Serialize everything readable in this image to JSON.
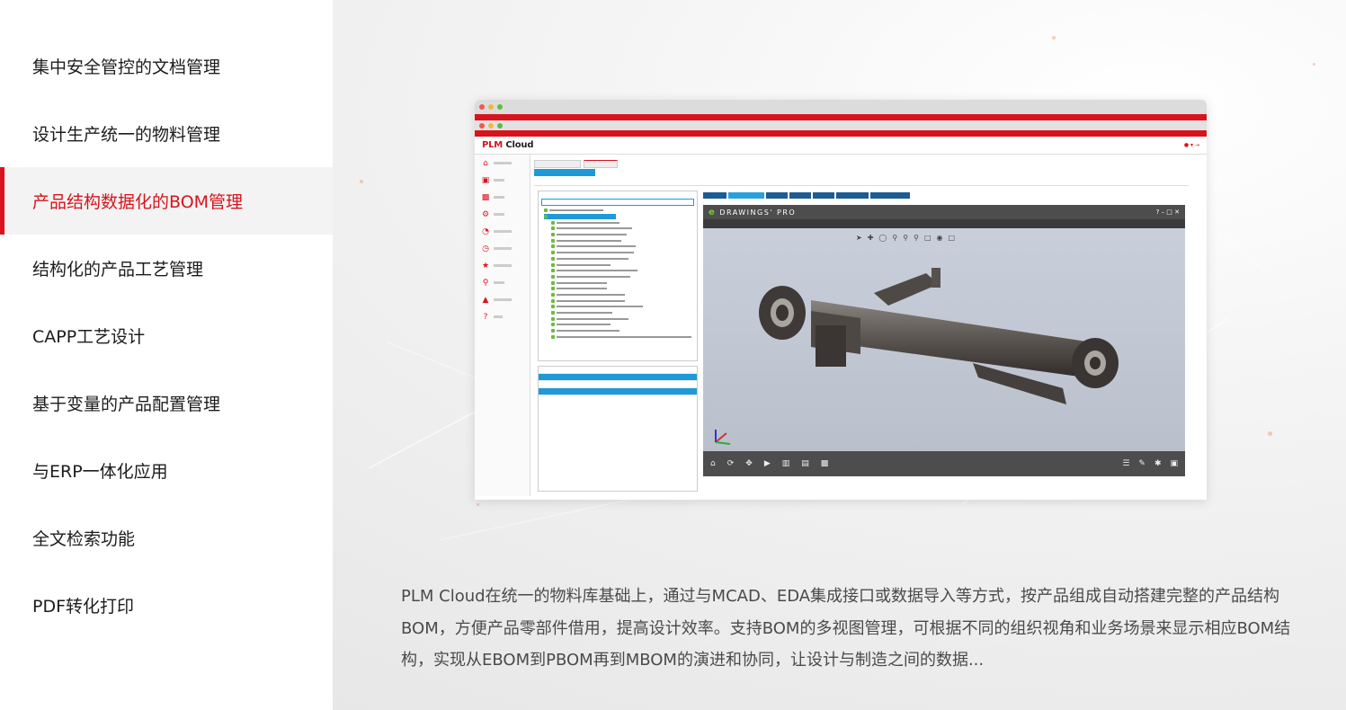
{
  "sidebar": {
    "items": [
      {
        "label": "集中安全管控的文档管理",
        "active": false
      },
      {
        "label": "设计生产统一的物料管理",
        "active": false
      },
      {
        "label": "产品结构数据化的BOM管理",
        "active": true
      },
      {
        "label": "结构化的产品工艺管理",
        "active": false
      },
      {
        "label": "CAPP工艺设计",
        "active": false
      },
      {
        "label": "基于变量的产品配置管理",
        "active": false
      },
      {
        "label": "与ERP一体化应用",
        "active": false
      },
      {
        "label": "全文检索功能",
        "active": false
      },
      {
        "label": "PDF转化打印",
        "active": false
      }
    ],
    "active_color": "#d8131d"
  },
  "screenshot": {
    "logo_accent": "PLM",
    "logo_rest": "Cloud",
    "viewer_logo_e": "e",
    "viewer_logo_text": "DRAWINGS' PRO"
  },
  "description": "PLM Cloud在统一的物料库基础上，通过与MCAD、EDA集成接口或数据导入等方式，按产品组成自动搭建完整的产品结构BOM，方便产品零部件借用，提高设计效率。支持BOM的多视图管理，可根据不同的组织视角和业务场景来显示相应BOM结构，实现从EBOM到PBOM再到MBOM的演进和协同，让设计与制造之间的数据..."
}
